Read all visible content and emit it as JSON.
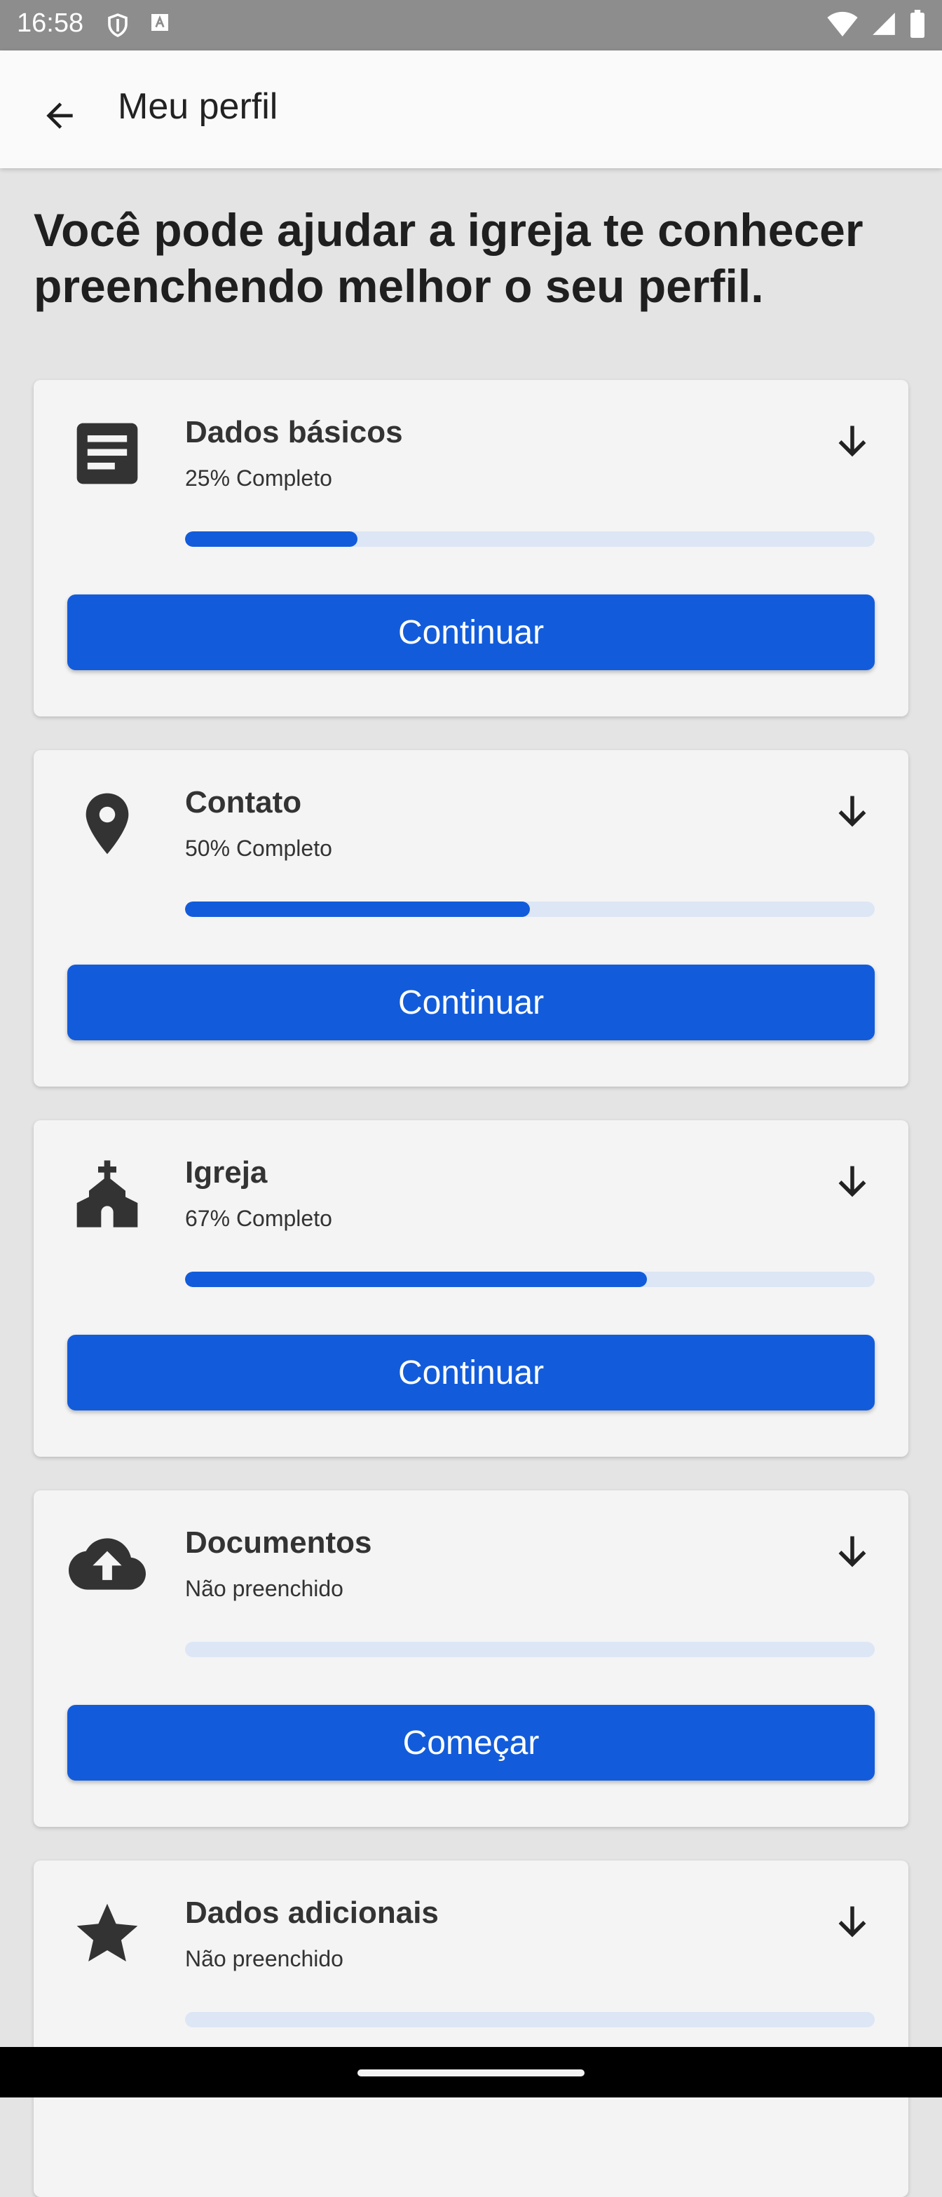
{
  "status_bar": {
    "time": "16:58"
  },
  "app_bar": {
    "title": "Meu perfil"
  },
  "headline": "Você pode ajudar a igreja te conhecer preenchendo melhor o seu perfil.",
  "cards": [
    {
      "title": "Dados básicos",
      "status": "25% Completo",
      "progress": 0.25,
      "button": "Continuar",
      "icon": "document-lines-icon"
    },
    {
      "title": "Contato",
      "status": "50% Completo",
      "progress": 0.5,
      "button": "Continuar",
      "icon": "location-pin-icon"
    },
    {
      "title": "Igreja",
      "status": "67% Completo",
      "progress": 0.67,
      "button": "Continuar",
      "icon": "church-icon"
    },
    {
      "title": "Documentos",
      "status": "Não preenchido",
      "progress": 0,
      "button": "Começar",
      "icon": "cloud-upload-icon"
    },
    {
      "title": "Dados adicionais",
      "status": "Não preenchido",
      "progress": 0,
      "button": "",
      "icon": "star-icon"
    }
  ],
  "colors": {
    "accent": "#125cdb",
    "track": "#dde6f5",
    "background": "#e4e4e4",
    "card": "#f4f4f4"
  }
}
